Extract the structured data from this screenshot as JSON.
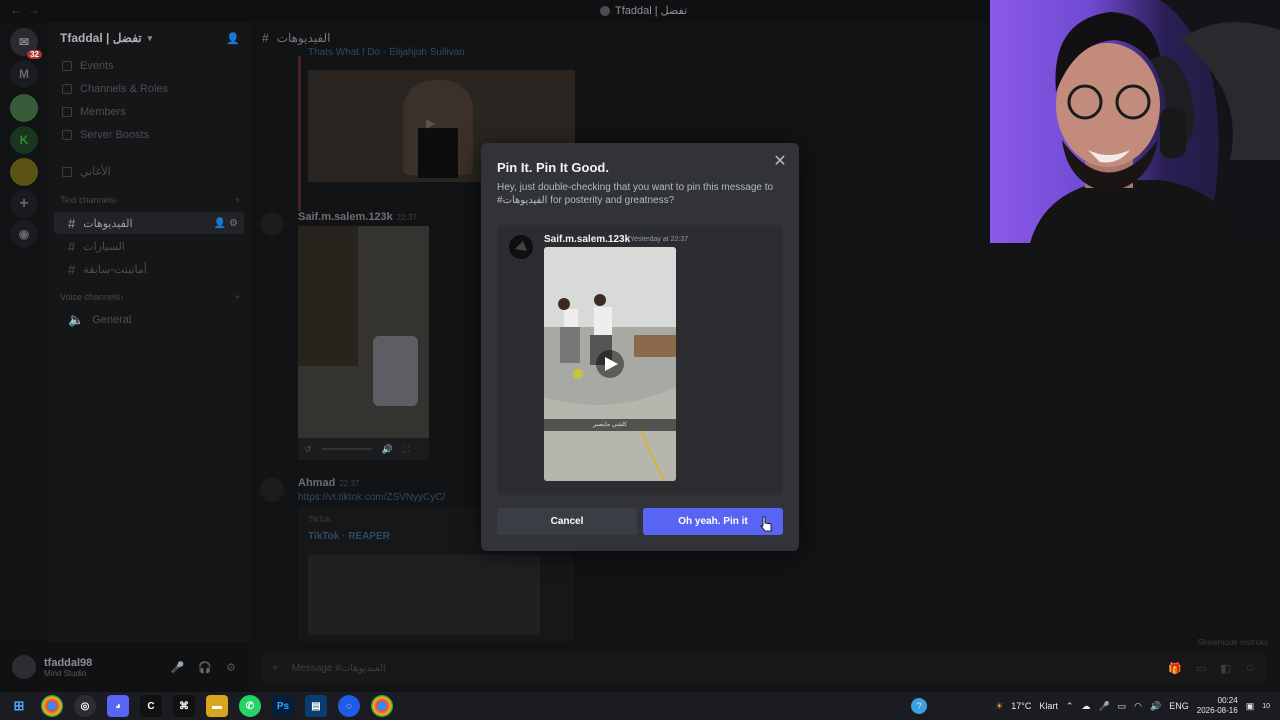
{
  "titlebar": {
    "title": "Tfaddal | تفضل"
  },
  "guilds": {
    "home_badge": "32",
    "m_label": "M"
  },
  "server": {
    "name": "Tfaddal | تفضل"
  },
  "sidebar": {
    "items": [
      "Events",
      "Channels & Roles",
      "Members",
      "Server Boosts"
    ],
    "hidden_channel": "الأغاني",
    "text_category": "Text channels",
    "text_channels": [
      "الفيديوهات",
      "السيارات",
      "أمانيتت-سابقة"
    ],
    "voice_category": "Voice channels",
    "voice_channels": [
      "General"
    ]
  },
  "chat": {
    "channel_name": "الفيديوهات",
    "top_link": "Thats What I Do - Elijahjoh Sullivan",
    "message1_author": "Saif.m.salem.123k",
    "message1_time": "22:37",
    "message2_author": "Ahmad",
    "message2_time": "22:37",
    "message2_link": "https://vt.tiktok.com/ZSVNyyCyC/",
    "embed_source": "TikTok",
    "embed_title": "TikTok · REAPER",
    "composer_placeholder": "Message #الفيديوهات",
    "showmode": "Showmode Instruks"
  },
  "user": {
    "name": "tfaddal98",
    "status": "Mind Studio"
  },
  "modal": {
    "title": "Pin It. Pin It Good.",
    "description": "Hey, just double-checking that you want to pin this message to #الفيديوهات for posterity and greatness?",
    "preview_author": "Saif.m.salem.123k",
    "preview_time": "Yesterday at 22:37",
    "video_caption": "كلشي مايصير",
    "cancel_label": "Cancel",
    "confirm_label": "Oh yeah. Pin it"
  },
  "taskbar": {
    "temperature": "17°C",
    "weather": "Klart",
    "language": "ENG",
    "time": "00:24",
    "date": "2026-08-16",
    "notification_count": "10"
  },
  "colors": {
    "blurple": "#5865f2",
    "modal_bg": "#313338",
    "cancel_bg": "#3b3d44"
  }
}
